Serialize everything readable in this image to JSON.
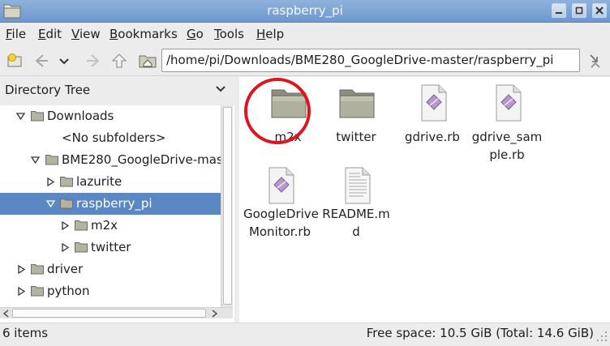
{
  "window": {
    "title": "raspberry_pi"
  },
  "menu": [
    {
      "label": "File",
      "accel": "F",
      "rest": "ile"
    },
    {
      "label": "Edit",
      "accel": "E",
      "rest": "dit"
    },
    {
      "label": "View",
      "accel": "V",
      "rest": "iew"
    },
    {
      "label": "Bookmarks",
      "accel": "B",
      "rest": "ookmarks"
    },
    {
      "label": "Go",
      "accel": "G",
      "rest": "o"
    },
    {
      "label": "Tools",
      "accel": "T",
      "rest": "ools"
    },
    {
      "label": "Help",
      "accel": "H",
      "rest": "elp"
    }
  ],
  "toolbar": {
    "path": "/home/pi/Downloads/BME280_GoogleDrive-master/raspberry_pi"
  },
  "sidebar": {
    "title": "Directory Tree",
    "tree": [
      {
        "label": "Downloads",
        "twisty": "open"
      },
      {
        "label": "<No subfolders>",
        "twisty": "none"
      },
      {
        "label": "BME280_GoogleDrive-mast",
        "twisty": "open"
      },
      {
        "label": "lazurite",
        "twisty": "closed"
      },
      {
        "label": "raspberry_pi",
        "twisty": "open",
        "selected": true
      },
      {
        "label": "m2x",
        "twisty": "closed"
      },
      {
        "label": "twitter",
        "twisty": "closed"
      },
      {
        "label": "driver",
        "twisty": "closed"
      },
      {
        "label": "python",
        "twisty": "closed"
      }
    ]
  },
  "files": [
    {
      "name": "m2x",
      "line1": "m2x",
      "line2": "",
      "type": "folder",
      "highlighted": true
    },
    {
      "name": "twitter",
      "line1": "twitter",
      "line2": "",
      "type": "folder"
    },
    {
      "name": "gdrive.rb",
      "line1": "gdrive.rb",
      "line2": "",
      "type": "ruby"
    },
    {
      "name": "gdrive_sample.rb",
      "line1": "gdrive_sam",
      "line2": "ple.rb",
      "type": "ruby"
    },
    {
      "name": "GoogleDriveMonitor.rb",
      "line1": "GoogleDrive",
      "line2": "Monitor.rb",
      "type": "ruby"
    },
    {
      "name": "README.md",
      "line1": "README.m",
      "line2": "d",
      "type": "text"
    }
  ],
  "status": {
    "items": "6 items",
    "free_space": "Free space: 10.5 GiB (Total: 14.6 GiB)"
  },
  "colors": {
    "titlebar": "#7aa2d6",
    "selection": "#5b88c2",
    "annotation_circle": "#e0141e",
    "folder": "#a9a99a"
  }
}
